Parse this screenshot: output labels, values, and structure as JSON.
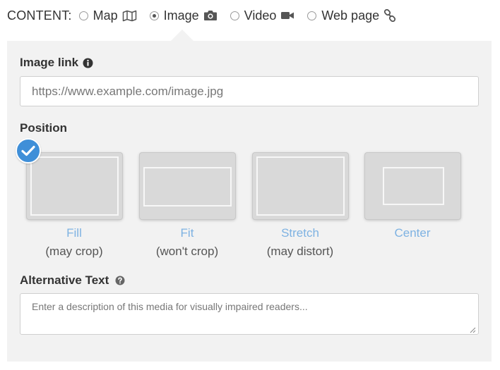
{
  "content_bar": {
    "label": "CONTENT:",
    "options": [
      {
        "label": "Map",
        "icon": "map-icon",
        "checked": false
      },
      {
        "label": "Image",
        "icon": "camera-icon",
        "checked": true
      },
      {
        "label": "Video",
        "icon": "video-camera-icon",
        "checked": false
      },
      {
        "label": "Web page",
        "icon": "link-icon",
        "checked": false
      }
    ]
  },
  "image_link": {
    "label": "Image link",
    "placeholder": "https://www.example.com/image.jpg",
    "value": "",
    "info_icon": "info-icon"
  },
  "position": {
    "label": "Position",
    "selected": "Fill",
    "options": [
      {
        "title": "Fill",
        "subtitle": "(may crop)"
      },
      {
        "title": "Fit",
        "subtitle": "(won't crop)"
      },
      {
        "title": "Stretch",
        "subtitle": "(may distort)"
      },
      {
        "title": "Center",
        "subtitle": ""
      }
    ]
  },
  "alt_text": {
    "label": "Alternative Text",
    "placeholder": "Enter a description of this media for visually impaired readers...",
    "value": "",
    "help_icon": "question-icon"
  },
  "colors": {
    "accent": "#3f8fd8",
    "link": "#7eb2e2",
    "panel_bg": "#f2f2f2"
  }
}
